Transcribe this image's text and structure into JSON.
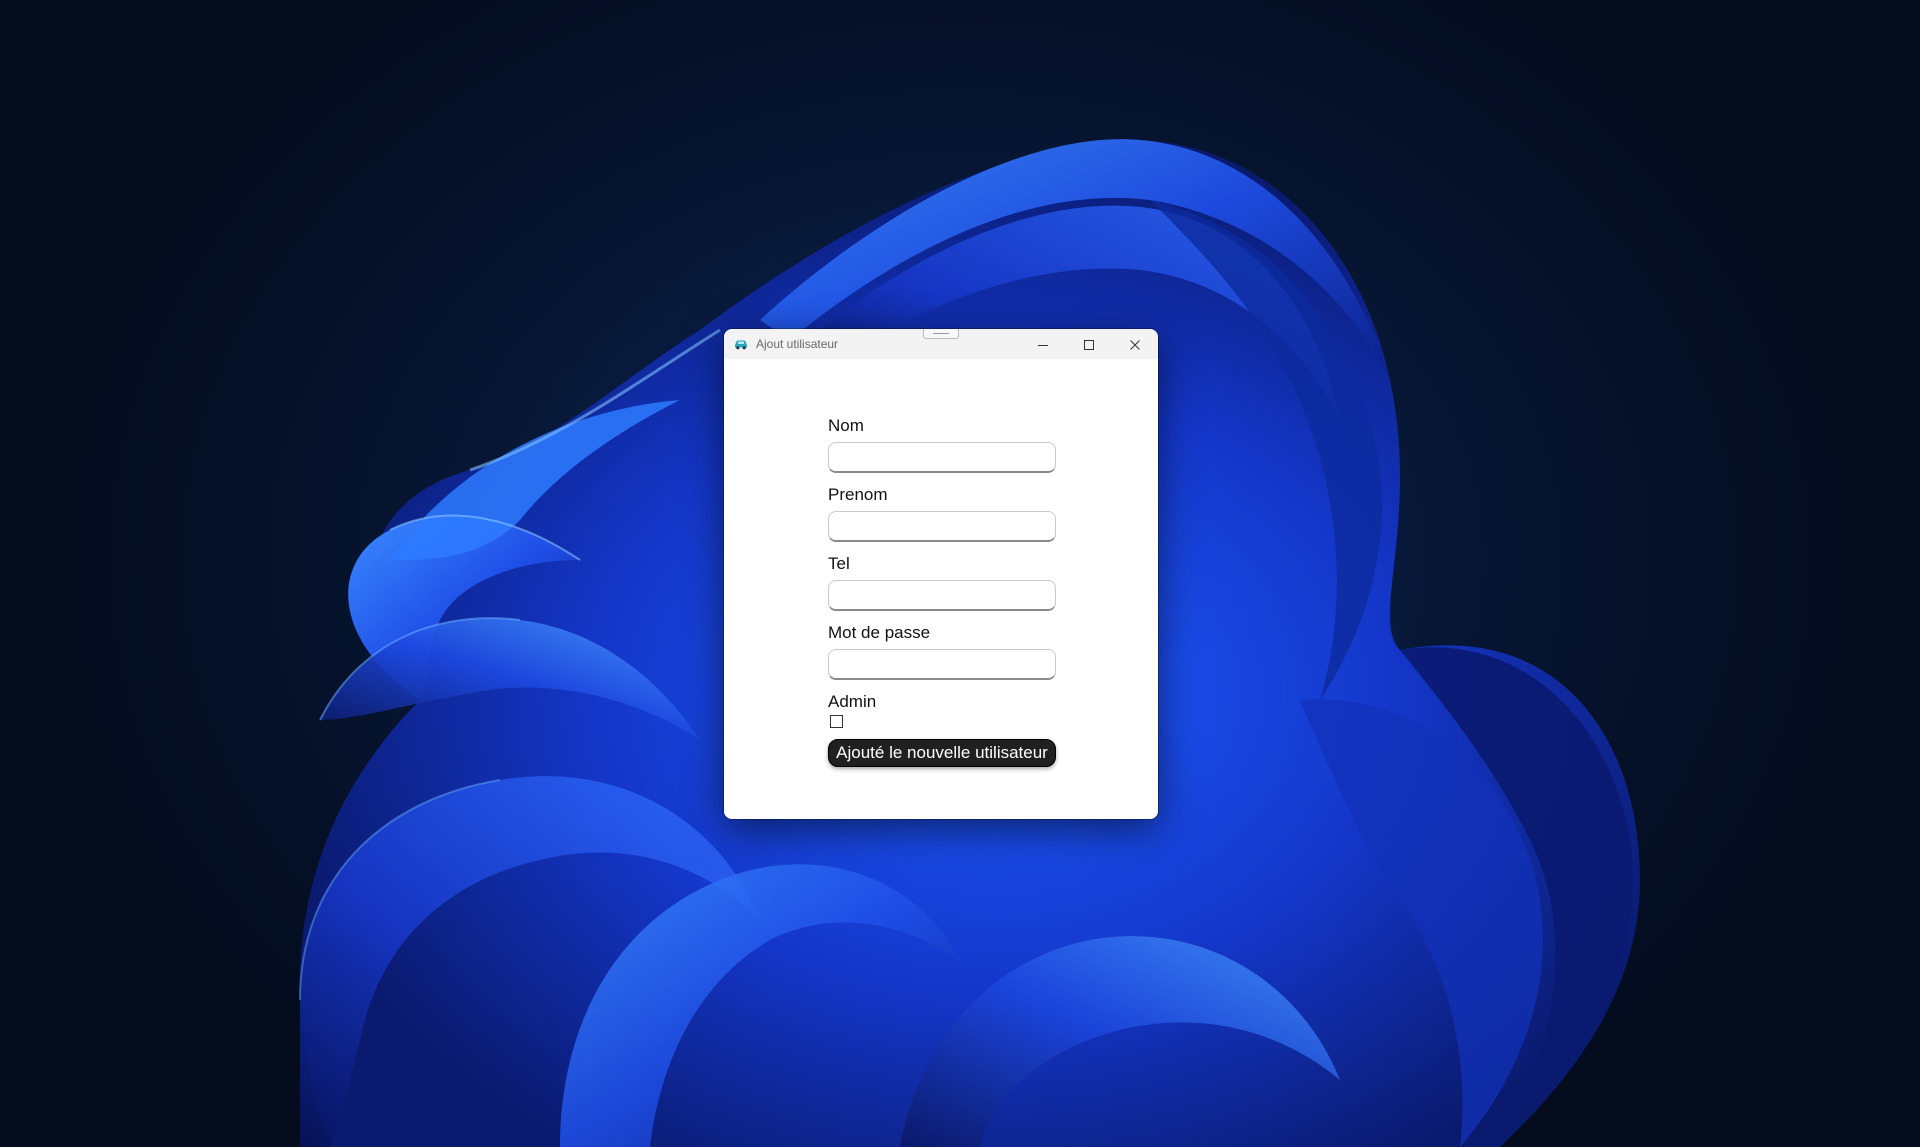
{
  "window": {
    "title": "Ajout utilisateur",
    "app_icon": "app-car-icon",
    "caption_icons": [
      "minimize-icon",
      "maximize-icon",
      "close-icon"
    ]
  },
  "form": {
    "nom_label": "Nom",
    "nom_value": "",
    "prenom_label": "Prenom",
    "prenom_value": "",
    "tel_label": "Tel",
    "tel_value": "",
    "password_label": "Mot de passe",
    "password_value": "",
    "admin_label": "Admin",
    "admin_checked": false,
    "submit_label": "Ajouté le nouvelle utilisateur"
  },
  "colors": {
    "button_bg": "#202020",
    "button_text": "#ffffff",
    "window_bg": "#ffffff",
    "wallpaper_accent": "#1b3fd6"
  }
}
